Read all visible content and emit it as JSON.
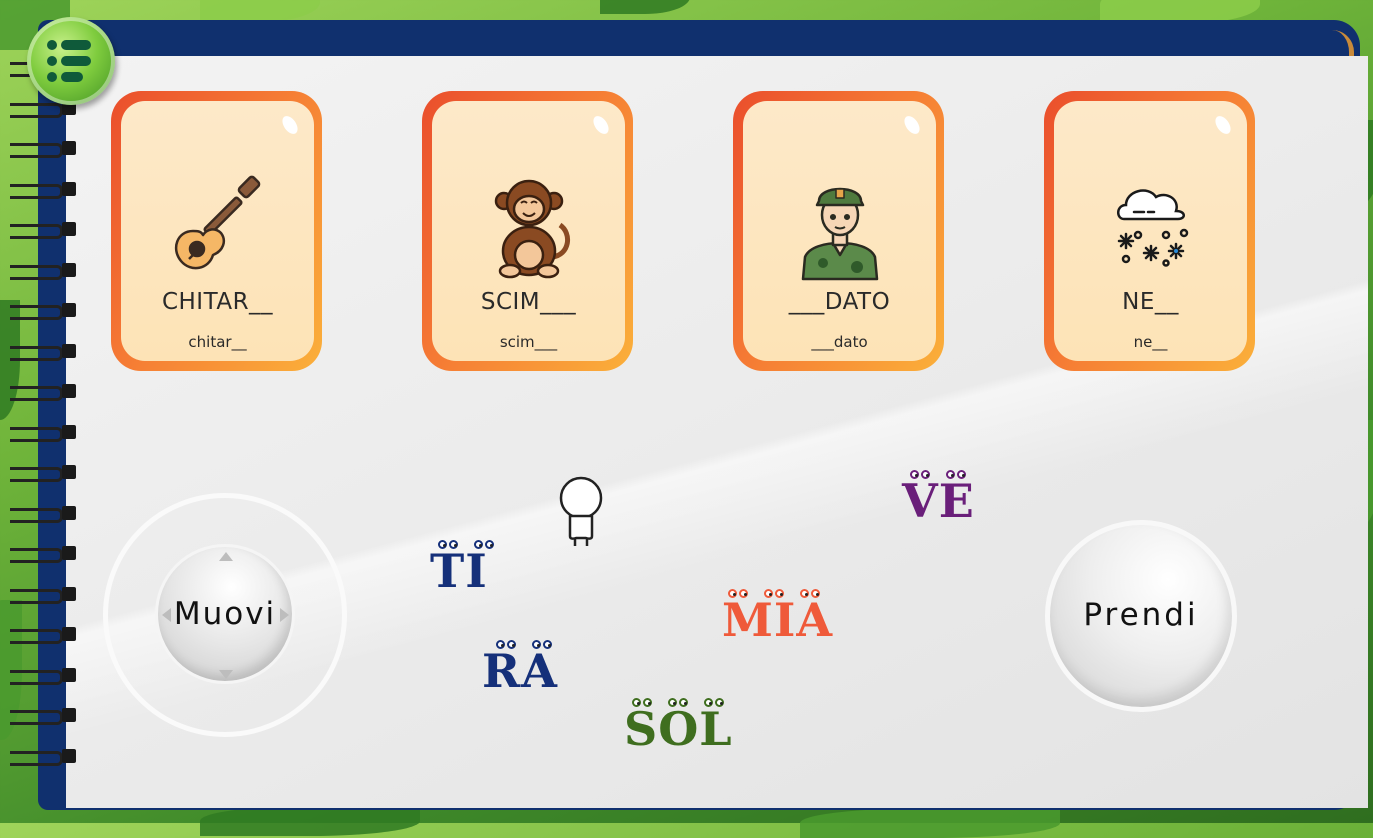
{
  "menu": {
    "icon": "list-menu-icon"
  },
  "cards": [
    {
      "icon": "guitar-icon",
      "upper": "CHITAR__",
      "lower": "chitar__"
    },
    {
      "icon": "monkey-icon",
      "upper": "SCIM___",
      "lower": "scim___"
    },
    {
      "icon": "soldier-icon",
      "upper": "___DATO",
      "lower": "___dato"
    },
    {
      "icon": "snow-cloud-icon",
      "upper": "NE__",
      "lower": "ne__"
    }
  ],
  "controls": {
    "move_label": "Muovi",
    "take_label": "Prendi"
  },
  "syllables": [
    {
      "text": "TI",
      "color": "#15307a"
    },
    {
      "text": "RA",
      "color": "#15307a"
    },
    {
      "text": "SOL",
      "color": "#3f6e1f"
    },
    {
      "text": "MIA",
      "color": "#ef5a3a"
    },
    {
      "text": "VE",
      "color": "#6a1f7a"
    }
  ],
  "colors": {
    "frame": "#10306e",
    "card_border": "#f57a34",
    "card_fill": "#fde6c0"
  }
}
